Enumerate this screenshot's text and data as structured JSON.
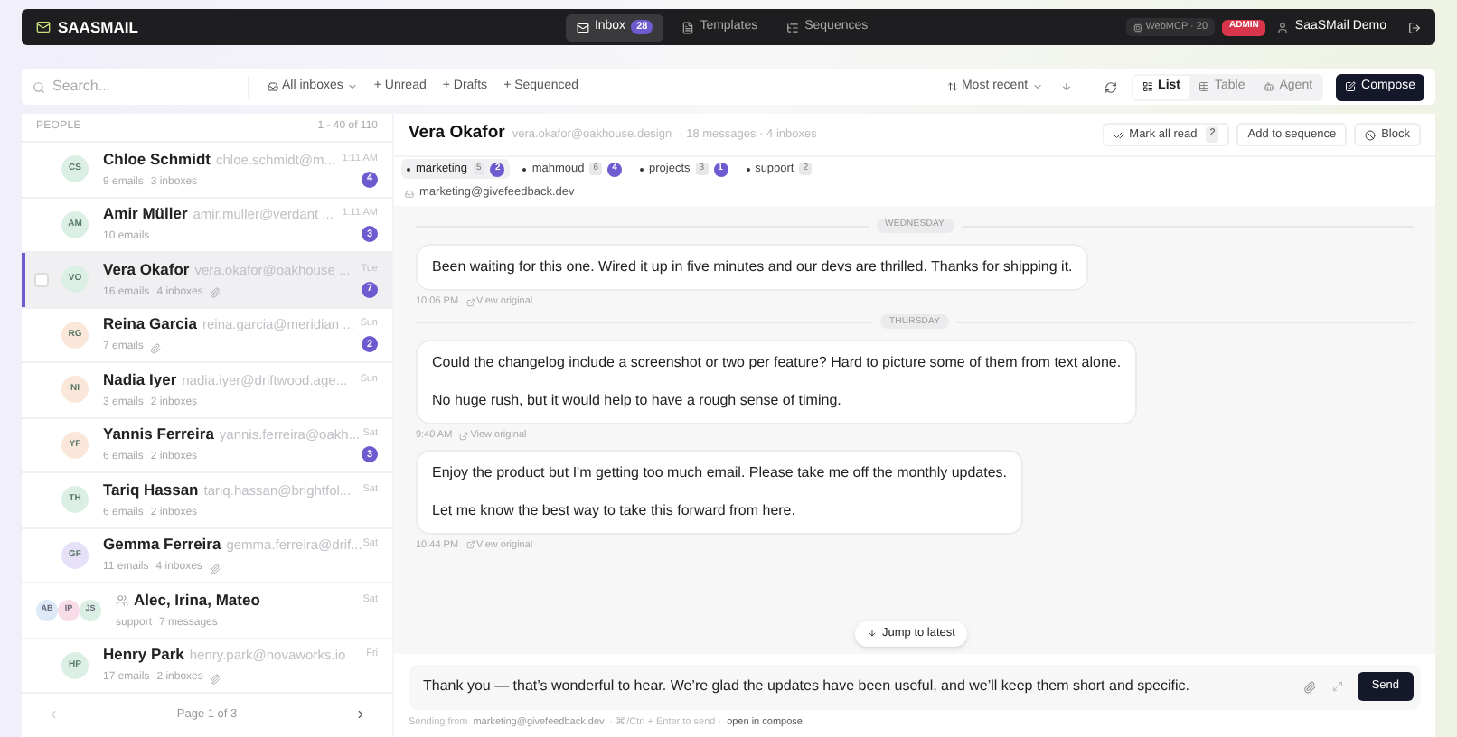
{
  "topbar": {
    "brand": "SAASMAIL",
    "nav": [
      {
        "label": "Inbox",
        "count": "28",
        "selected": true,
        "kind": "inbox"
      },
      {
        "label": "Templates",
        "selected": false,
        "kind": "templates"
      },
      {
        "label": "Sequences",
        "selected": false,
        "kind": "sequences"
      }
    ],
    "mcp": "WebMCP · 20",
    "role": "ADMIN",
    "user": "SaaSMail Demo"
  },
  "toolbar": {
    "search_placeholder": "Search...",
    "inbox_filter": "All inboxes",
    "filters": [
      "+ Unread",
      "+ Drafts",
      "+ Sequenced"
    ],
    "sort": "Most recent",
    "views": [
      {
        "label": "List",
        "selected": true,
        "kind": "list"
      },
      {
        "label": "Table",
        "selected": false,
        "kind": "table"
      },
      {
        "label": "Agent",
        "selected": false,
        "kind": "agent"
      }
    ],
    "compose": "Compose"
  },
  "people": {
    "heading": "PEOPLE",
    "range": "1 - 40 of 110",
    "rows": [
      {
        "kind": "person",
        "initials": "CS",
        "color": "#dcefe4",
        "name": "Chloe Schmidt",
        "email": "chloe.schmidt@m...",
        "emails": "9 emails",
        "inboxes": "3 inboxes",
        "attachment": false,
        "time": "1:11 AM",
        "unread": "4",
        "selected": false
      },
      {
        "kind": "person",
        "initials": "AM",
        "color": "#dcefe4",
        "name": "Amir Müller",
        "email": "amir.müller@verdant ...",
        "emails": "10 emails",
        "attachment": false,
        "time": "1:11 AM",
        "unread": "3",
        "selected": false
      },
      {
        "kind": "person",
        "initials": "VO",
        "color": "#dcefe4",
        "name": "Vera Okafor",
        "email": "vera.okafor@oakhouse ...",
        "emails": "16 emails",
        "inboxes": "4 inboxes",
        "attachment": true,
        "time": "Tue",
        "unread": "7",
        "selected": true
      },
      {
        "kind": "person",
        "initials": "RG",
        "color": "#fbe6da",
        "name": "Reina Garcia",
        "email": "reina.garcia@meridian ...",
        "emails": "7 emails",
        "attachment": true,
        "time": "Sun",
        "unread": "2",
        "selected": false
      },
      {
        "kind": "person",
        "initials": "NI",
        "color": "#fbe6da",
        "name": "Nadia Iyer",
        "email": "nadia.iyer@driftwood.age...",
        "emails": "3 emails",
        "inboxes": "2 inboxes",
        "attachment": false,
        "time": "Sun",
        "selected": false
      },
      {
        "kind": "person",
        "initials": "YF",
        "color": "#fbe6da",
        "name": "Yannis Ferreira",
        "email": "yannis.ferreira@oakh...",
        "emails": "6 emails",
        "inboxes": "2 inboxes",
        "attachment": false,
        "time": "Sat",
        "unread": "3",
        "selected": false
      },
      {
        "kind": "person",
        "initials": "TH",
        "color": "#dcefe4",
        "name": "Tariq Hassan",
        "email": "tariq.hassan@brightfol...",
        "emails": "6 emails",
        "inboxes": "2 inboxes",
        "attachment": false,
        "time": "Sat",
        "selected": false
      },
      {
        "kind": "person",
        "initials": "GF",
        "color": "#e6e0f8",
        "name": "Gemma Ferreira",
        "email": "gemma.ferreira@drif...",
        "emails": "11 emails",
        "inboxes": "4 inboxes",
        "attachment": true,
        "time": "Sat",
        "selected": false
      },
      {
        "kind": "group",
        "avatars": [
          {
            "initials": "AB",
            "color": "#dde9f8"
          },
          {
            "initials": "IP",
            "color": "#f8dde8"
          },
          {
            "initials": "JS",
            "color": "#dcefe4"
          }
        ],
        "name": "Alec, Irina, Mateo",
        "inbox": "support",
        "messages": "7 messages",
        "time": "Sat",
        "selected": false
      },
      {
        "kind": "person",
        "initials": "HP",
        "color": "#dcefe4",
        "name": "Henry Park",
        "email": "henry.park@novaworks.io",
        "emails": "17 emails",
        "inboxes": "2 inboxes",
        "attachment": true,
        "time": "Fri",
        "selected": false
      }
    ],
    "page": "Page 1 of 3"
  },
  "thread": {
    "name": "Vera Okafor",
    "email": "vera.okafor@oakhouse.design",
    "meta": "· 18 messages · 4 inboxes",
    "mark_read": "Mark all read",
    "mark_read_count": "2",
    "add_sequence": "Add to sequence",
    "block": "Block",
    "inbox_tabs": [
      {
        "label": "marketing",
        "count": "5",
        "unread": "2",
        "selected": true
      },
      {
        "label": "mahmoud",
        "count": "6",
        "unread": "4",
        "selected": false
      },
      {
        "label": "projects",
        "count": "3",
        "unread": "1",
        "selected": false
      },
      {
        "label": "support",
        "count": "2",
        "selected": false
      }
    ],
    "address": "marketing@givefeedback.dev",
    "items": [
      {
        "kind": "day",
        "label": "WEDNESDAY"
      },
      {
        "kind": "message",
        "paragraphs": [
          "Been waiting for this one. Wired it up in five minutes and our devs are thrilled. Thanks for shipping it."
        ],
        "time": "10:06 PM",
        "link": "View original"
      },
      {
        "kind": "day",
        "label": "THURSDAY"
      },
      {
        "kind": "message",
        "paragraphs": [
          "Could the changelog include a screenshot or two per feature? Hard to picture some of them from text alone.",
          "No huge rush, but it would help to have a rough sense of timing."
        ],
        "time": "9:40 AM",
        "link": "View original"
      },
      {
        "kind": "message",
        "paragraphs": [
          "Enjoy the product but I'm getting too much email. Please take me off the monthly updates.",
          "Let me know the best way to take this forward from here."
        ],
        "time": "10:44 PM",
        "link": "View original"
      }
    ],
    "jump": "Jump to latest",
    "composer": {
      "value": "Thank you — that’s wonderful to hear. We’re glad the updates have been useful, and we’ll keep them short and specific.",
      "send": "Send"
    },
    "footer": {
      "prefix": "Sending from",
      "address": "marketing@givefeedback.dev",
      "hint": "· ⌘/Ctrl + Enter to send ·",
      "link": "open in compose"
    }
  }
}
